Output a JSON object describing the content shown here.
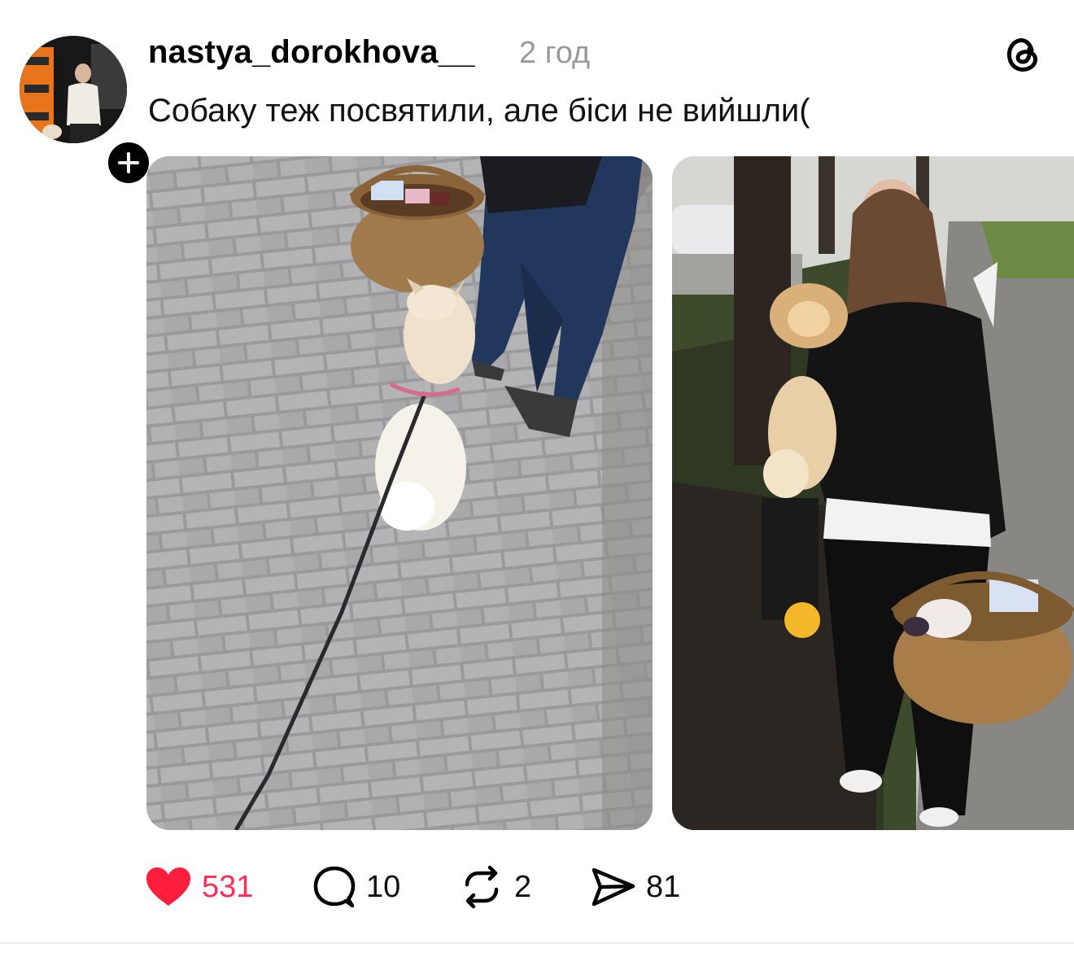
{
  "post": {
    "username": "nastya_dorokhova__",
    "time": "2 год",
    "caption": "Собаку теж посвятили, але біси не вийшли("
  },
  "actions": {
    "likes": "531",
    "replies": "10",
    "reposts": "2",
    "shares": "81"
  },
  "icons": {
    "like": "heart-icon",
    "reply": "speech-bubble-icon",
    "repost": "repost-arrows-icon",
    "share": "send-paper-plane-icon",
    "app": "threads-logo-icon",
    "follow": "plus-icon"
  },
  "colors": {
    "like_active": "#ff2d55",
    "timestamp": "#999999",
    "text": "#000000"
  }
}
